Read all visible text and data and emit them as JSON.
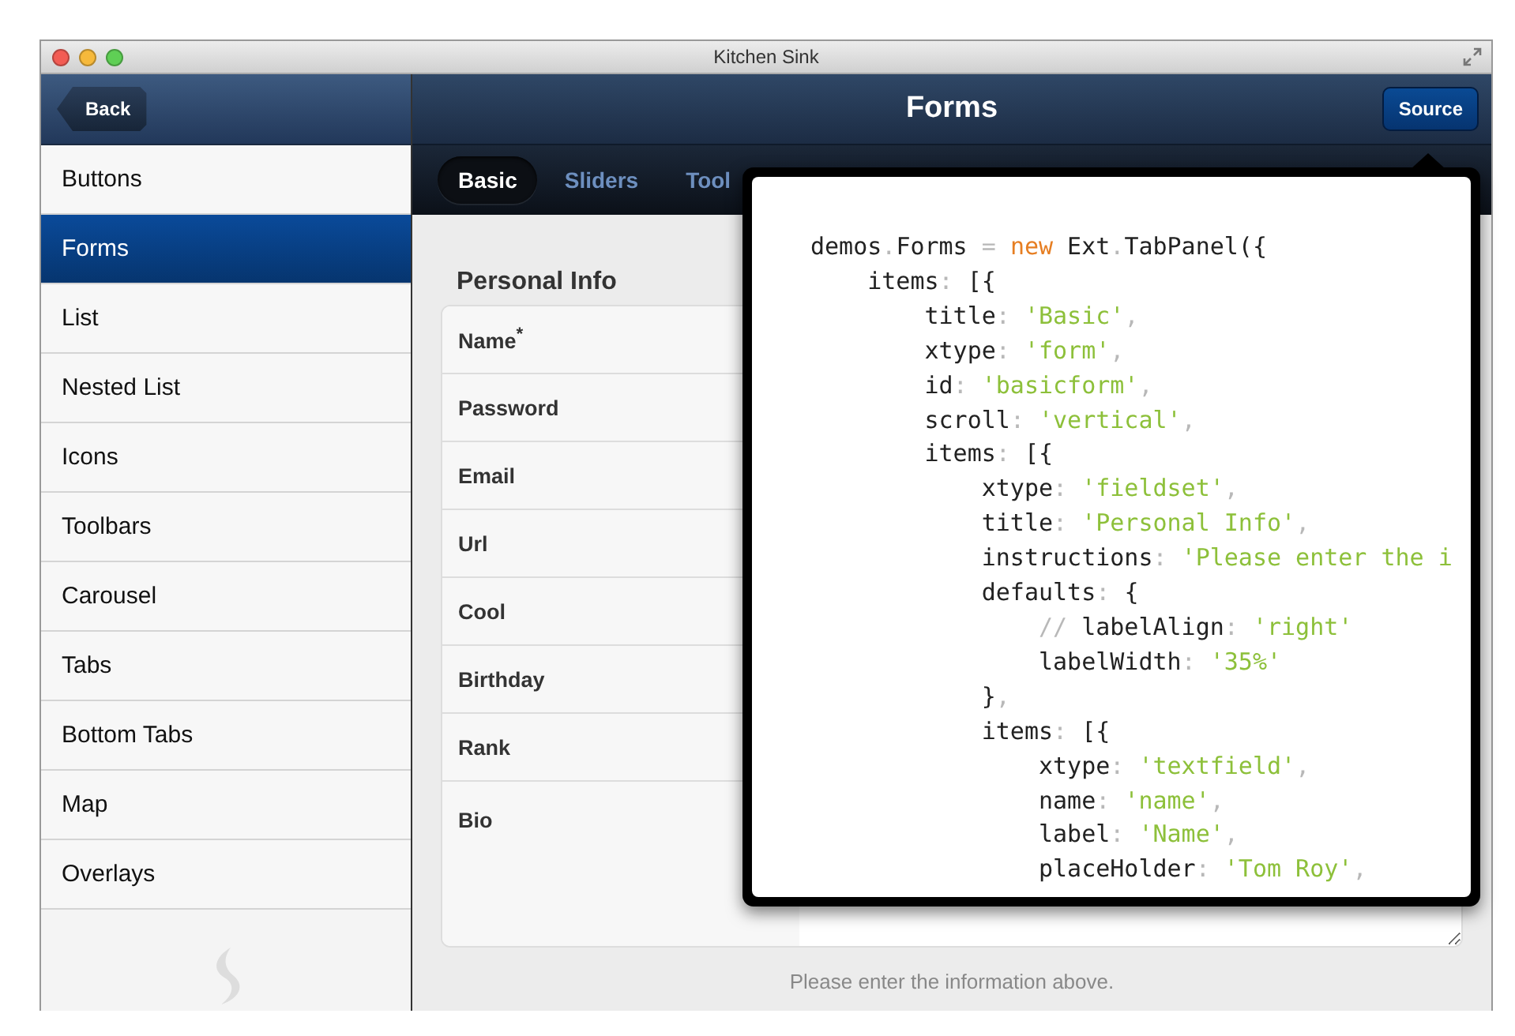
{
  "window": {
    "title": "Kitchen Sink"
  },
  "sidebar": {
    "back": "Back",
    "items": [
      {
        "label": "Buttons",
        "selected": false
      },
      {
        "label": "Forms",
        "selected": true
      },
      {
        "label": "List",
        "selected": false
      },
      {
        "label": "Nested List",
        "selected": false
      },
      {
        "label": "Icons",
        "selected": false
      },
      {
        "label": "Toolbars",
        "selected": false
      },
      {
        "label": "Carousel",
        "selected": false
      },
      {
        "label": "Tabs",
        "selected": false
      },
      {
        "label": "Bottom Tabs",
        "selected": false
      },
      {
        "label": "Map",
        "selected": false
      },
      {
        "label": "Overlays",
        "selected": false
      }
    ]
  },
  "header": {
    "title": "Forms",
    "source_button": "Source"
  },
  "tabs": [
    {
      "label": "Basic",
      "selected": true
    },
    {
      "label": "Sliders",
      "selected": false
    },
    {
      "label": "Tool",
      "selected": false
    }
  ],
  "fieldset": {
    "title": "Personal Info",
    "fields": [
      {
        "label": "Name$^{*}$",
        "kind": "text"
      },
      {
        "label": "Password",
        "kind": "text"
      },
      {
        "label": "Email",
        "kind": "text"
      },
      {
        "label": "Url",
        "kind": "text"
      },
      {
        "label": "Cool",
        "kind": "text"
      },
      {
        "label": "Birthday",
        "kind": "text"
      },
      {
        "label": "Rank",
        "kind": "text"
      },
      {
        "label": "Bio",
        "kind": "textarea"
      }
    ],
    "instructions": "Please enter the information above."
  },
  "source_popover": {
    "lines": [
      [
        {
          "kind": "plain",
          "text": "demos"
        },
        {
          "kind": "punct",
          "text": "."
        },
        {
          "kind": "plain",
          "text": "Forms "
        },
        {
          "kind": "punct",
          "text": "= "
        },
        {
          "kind": "keyword",
          "text": "new"
        },
        {
          "kind": "plain",
          "text": " Ext"
        },
        {
          "kind": "punct",
          "text": "."
        },
        {
          "kind": "plain",
          "text": "TabPanel({"
        }
      ],
      [
        {
          "kind": "plain",
          "text": "    items"
        },
        {
          "kind": "punct",
          "text": ": "
        },
        {
          "kind": "plain",
          "text": "[{"
        }
      ],
      [
        {
          "kind": "plain",
          "text": "        title"
        },
        {
          "kind": "punct",
          "text": ": "
        },
        {
          "kind": "string",
          "text": "'Basic'"
        },
        {
          "kind": "punct",
          "text": ","
        }
      ],
      [
        {
          "kind": "plain",
          "text": "        xtype"
        },
        {
          "kind": "punct",
          "text": ": "
        },
        {
          "kind": "string",
          "text": "'form'"
        },
        {
          "kind": "punct",
          "text": ","
        }
      ],
      [
        {
          "kind": "plain",
          "text": "        id"
        },
        {
          "kind": "punct",
          "text": ": "
        },
        {
          "kind": "string",
          "text": "'basicform'"
        },
        {
          "kind": "punct",
          "text": ","
        }
      ],
      [
        {
          "kind": "plain",
          "text": "        scroll"
        },
        {
          "kind": "punct",
          "text": ": "
        },
        {
          "kind": "string",
          "text": "'vertical'"
        },
        {
          "kind": "punct",
          "text": ","
        }
      ],
      [
        {
          "kind": "plain",
          "text": "        items"
        },
        {
          "kind": "punct",
          "text": ": "
        },
        {
          "kind": "plain",
          "text": "[{"
        }
      ],
      [
        {
          "kind": "plain",
          "text": "            xtype"
        },
        {
          "kind": "punct",
          "text": ": "
        },
        {
          "kind": "string",
          "text": "'fieldset'"
        },
        {
          "kind": "punct",
          "text": ","
        }
      ],
      [
        {
          "kind": "plain",
          "text": "            title"
        },
        {
          "kind": "punct",
          "text": ": "
        },
        {
          "kind": "string",
          "text": "'Personal Info'"
        },
        {
          "kind": "punct",
          "text": ","
        }
      ],
      [
        {
          "kind": "plain",
          "text": "            instructions"
        },
        {
          "kind": "punct",
          "text": ": "
        },
        {
          "kind": "string",
          "text": "'Please enter the i"
        }
      ],
      [
        {
          "kind": "plain",
          "text": "            defaults"
        },
        {
          "kind": "punct",
          "text": ": "
        },
        {
          "kind": "plain",
          "text": "{"
        }
      ],
      [
        {
          "kind": "comment",
          "text": "                // "
        },
        {
          "kind": "plain",
          "text": "labelAlign"
        },
        {
          "kind": "punct",
          "text": ": "
        },
        {
          "kind": "string",
          "text": "'right'"
        }
      ],
      [
        {
          "kind": "plain",
          "text": "                labelWidth"
        },
        {
          "kind": "punct",
          "text": ": "
        },
        {
          "kind": "string",
          "text": "'35%'"
        }
      ],
      [
        {
          "kind": "plain",
          "text": "            }"
        },
        {
          "kind": "punct",
          "text": ","
        }
      ],
      [
        {
          "kind": "plain",
          "text": "            items"
        },
        {
          "kind": "punct",
          "text": ": "
        },
        {
          "kind": "plain",
          "text": "[{"
        }
      ],
      [
        {
          "kind": "plain",
          "text": "                xtype"
        },
        {
          "kind": "punct",
          "text": ": "
        },
        {
          "kind": "string",
          "text": "'textfield'"
        },
        {
          "kind": "punct",
          "text": ","
        }
      ],
      [
        {
          "kind": "plain",
          "text": "                name"
        },
        {
          "kind": "punct",
          "text": ": "
        },
        {
          "kind": "string",
          "text": "'name'"
        },
        {
          "kind": "punct",
          "text": ","
        }
      ],
      [
        {
          "kind": "plain",
          "text": "                label"
        },
        {
          "kind": "punct",
          "text": ": "
        },
        {
          "kind": "string",
          "text": "'Name'"
        },
        {
          "kind": "punct",
          "text": ","
        }
      ],
      [
        {
          "kind": "plain",
          "text": "                placeHolder"
        },
        {
          "kind": "punct",
          "text": ": "
        },
        {
          "kind": "string",
          "text": "'Tom Roy'"
        },
        {
          "kind": "punct",
          "text": ","
        }
      ]
    ]
  }
}
